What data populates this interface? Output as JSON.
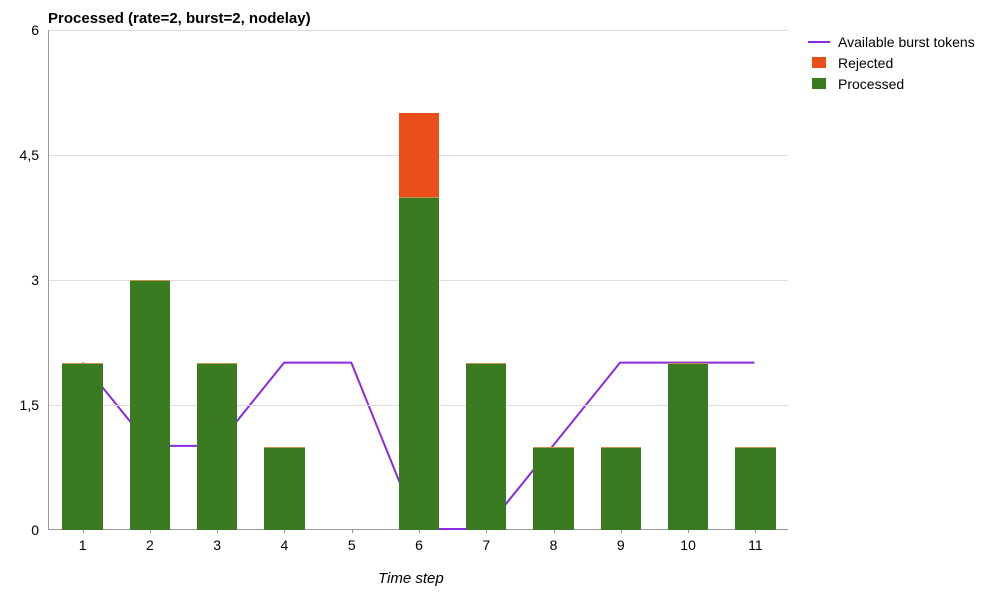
{
  "chart_data": {
    "type": "bar",
    "title": "Processed (rate=2, burst=2, nodelay)",
    "xlabel": "Time step",
    "ylabel": "",
    "ylim": [
      0,
      6
    ],
    "y_ticks": [
      0,
      1.5,
      3,
      4.5,
      6
    ],
    "y_tick_labels": [
      "0",
      "1,5",
      "3",
      "4,5",
      "6"
    ],
    "categories": [
      "1",
      "2",
      "3",
      "4",
      "5",
      "6",
      "7",
      "8",
      "9",
      "10",
      "11"
    ],
    "series": [
      {
        "name": "Processed",
        "type": "bar",
        "color": "#3a7b21",
        "values": [
          2,
          3,
          2,
          1,
          0,
          4,
          2,
          1,
          1,
          2,
          1
        ]
      },
      {
        "name": "Rejected",
        "type": "bar",
        "color": "#e94e1b",
        "values": [
          0,
          0,
          0,
          0,
          0,
          1,
          0,
          0,
          0,
          0,
          0
        ]
      },
      {
        "name": "Available burst tokens",
        "type": "line",
        "color": "#8a2be2",
        "values": [
          2,
          1,
          1,
          2,
          2,
          0,
          0,
          1,
          2,
          2,
          2
        ]
      }
    ],
    "legend_order": [
      "Available burst tokens",
      "Rejected",
      "Processed"
    ]
  }
}
